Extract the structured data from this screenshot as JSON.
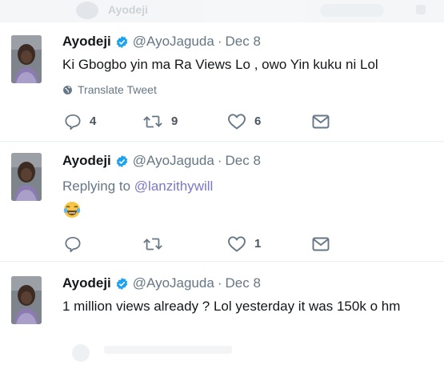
{
  "ghost_top": {
    "text": "Ayodeji"
  },
  "tweets": [
    {
      "name": "Ayodeji",
      "handle": "@AyoJaguda",
      "separator": "·",
      "date": "Dec 8",
      "text": "Ki Gbogbo yin ma Ra Views Lo , owo Yin kuku ni Lol",
      "translate_label": "Translate Tweet",
      "replies": "4",
      "retweets": "9",
      "likes": "6"
    },
    {
      "name": "Ayodeji",
      "handle": "@AyoJaguda",
      "separator": "·",
      "date": "Dec 8",
      "replying_prefix": "Replying to",
      "replying_handle": "@lanzithywill",
      "emoji": "face-with-tears-of-joy",
      "replies": "",
      "retweets": "",
      "likes": "1"
    },
    {
      "name": "Ayodeji",
      "handle": "@AyoJaguda",
      "separator": "·",
      "date": "Dec 8",
      "text": "1 million views already ? Lol yesterday it was 150k o hm"
    }
  ],
  "colors": {
    "verified": "#1da1f2",
    "muted": "#657786",
    "mention": "#7a78c8",
    "divider": "#e6ecf0"
  }
}
